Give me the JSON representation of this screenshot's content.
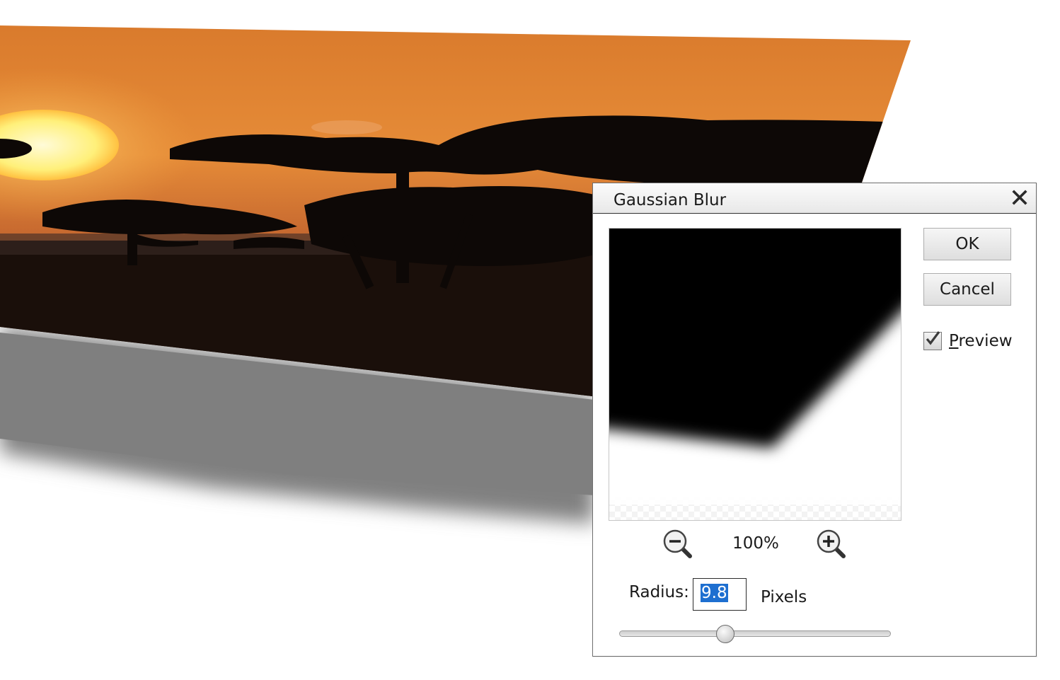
{
  "dialog": {
    "title": "Gaussian Blur",
    "close_icon": "close-icon",
    "zoom_level": "100%",
    "zoom_out_icon": "zoom-out-icon",
    "zoom_in_icon": "zoom-in-icon",
    "radius_label": "Radius:",
    "radius_value": "9.8",
    "units_label": "Pixels",
    "slider_fraction": 0.39,
    "ok_label": "OK",
    "cancel_label": "Cancel",
    "preview_label_mnemonic": "P",
    "preview_label_rest": "review",
    "preview_checked": true
  },
  "colors": {
    "sky_top": "#d97a2c",
    "sky_horizon": "#f2a14a",
    "sun": "#fff3a0",
    "shadow_gray": "#7f7f7f",
    "selection_blue": "#1e6fd0"
  }
}
